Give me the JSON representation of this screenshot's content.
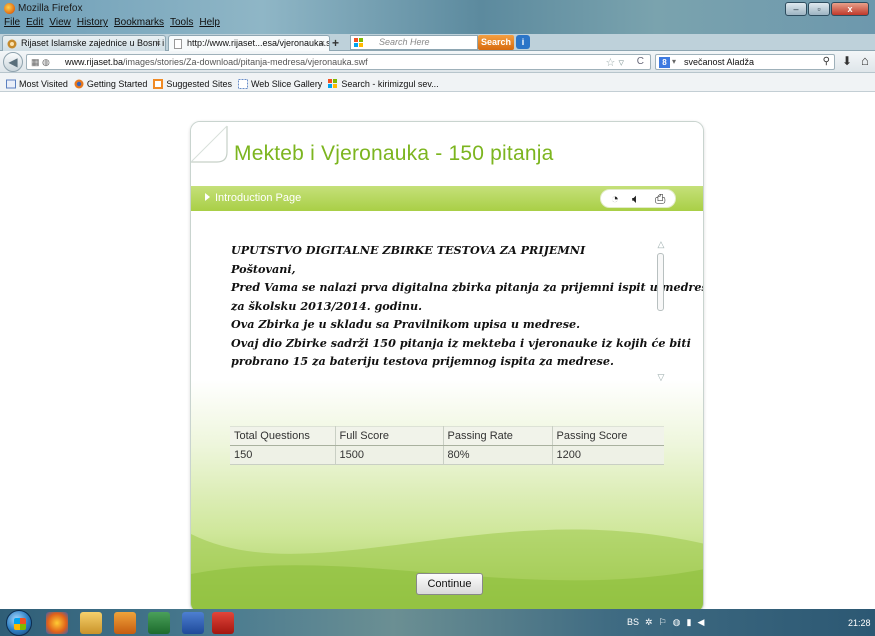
{
  "window": {
    "title": "Mozilla Firefox",
    "menus": [
      "File",
      "Edit",
      "View",
      "History",
      "Bookmarks",
      "Tools",
      "Help"
    ],
    "controls": {
      "minimize": "–",
      "maximize": "▫",
      "close": "x"
    }
  },
  "tabs": [
    {
      "label": "Rijaset Islamske zajednice u Bosni i H...",
      "active": false,
      "close": "×"
    },
    {
      "label": "http://www.rijaset...esa/vjeronauka.swf",
      "active": true,
      "close": "×"
    }
  ],
  "new_tab": "+",
  "toolbar_search": {
    "placeholder": "Search Here",
    "button": "Search"
  },
  "navigation": {
    "url_domain": "www.rijaset.ba",
    "url_path": "/images/stories/Za-download/pitanja-medresa/vjeronauka.swf",
    "search_value": "svečanost Aladža",
    "search_engine_glyph": "8"
  },
  "bookmarks": [
    {
      "label": "Most Visited",
      "icon": "firefox-icon"
    },
    {
      "label": "Getting Started",
      "icon": "firefox-icon"
    },
    {
      "label": "Suggested Sites",
      "icon": "suggested-sites-icon"
    },
    {
      "label": "Web Slice Gallery",
      "icon": "web-slice-icon"
    },
    {
      "label": "Search - kirimizgul sev...",
      "icon": "search-engine-icon"
    }
  ],
  "quiz": {
    "title": "Mekteb i Vjeronauka - 150 pitanja",
    "breadcrumb": "Introduction Page",
    "intro_lines": [
      "UPUTSTVO DIGITALNE ZBIRKE TESTOVA ZA PRIJEMNI",
      "Poštovani,",
      "Pred Vama se nalazi prva digitalna zbirka pitanja za prijemni ispit u medrese",
      "za školsku 2013/2014. godinu.",
      "Ova Zbirka je u skladu sa Pravilnikom upisa u medrese.",
      "Ovaj dio Zbirke sadrži 150 pitanja iz mekteba i vjeronauke iz kojih će biti",
      "probrano 15 za bateriju testova prijemnog ispita za medrese."
    ],
    "stats_headers": [
      "Total Questions",
      "Full Score",
      "Passing Rate",
      "Passing Score"
    ],
    "stats_values": [
      "150",
      "1500",
      "80%",
      "1200"
    ],
    "continue_label": "Continue",
    "accent_color": "#7cb51f"
  },
  "taskbar": {
    "tray_label": "BS",
    "clock": "21:28"
  }
}
